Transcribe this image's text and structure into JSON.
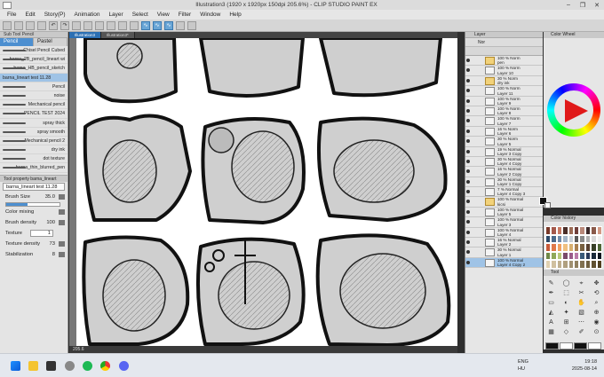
{
  "window": {
    "title": "Illustration3 (1920 x 1920px 150dpi 205.6%)  - CLIP STUDIO PAINT EX",
    "buttons": [
      "–",
      "❐",
      "✕"
    ]
  },
  "menu": [
    "File",
    "Edit",
    "Story(P)",
    "Animation",
    "Layer",
    "Select",
    "View",
    "Filter",
    "Window",
    "Help"
  ],
  "subtool_panel": {
    "title": "Sub Tool  Pencil",
    "tabs": [
      "Pencil",
      "Pastel"
    ],
    "brushes": [
      "Chisel Pencil Cubed",
      "barna_2B_pencil_lineart wi",
      "barna_HB_pencil_sketch",
      "barna_lineart test 11.28",
      "Pencil",
      "noise",
      "Mechanical pencil",
      "PENCIL TEST 2024",
      "spray thick",
      "spray smooth",
      "Mechanical pencil 2",
      "dry ink",
      "dot texture",
      "barna_thin_blurred_pen"
    ],
    "selected_index": 3
  },
  "tool_property": {
    "title": "Tool property  barna_lineart",
    "name": "barna_lineart test 11.28",
    "brush_size_label": "Brush Size",
    "brush_size_value": "35.0",
    "color_mixing_label": "Color mixing",
    "brush_density_label": "Brush density",
    "brush_density_value": "100",
    "texture_label": "Texture",
    "texture_value": "1",
    "texture_density_label": "Texture density",
    "texture_density_value": "73",
    "stabilization_label": "Stabilization",
    "stabilization_value": "8"
  },
  "canvas": {
    "tabs": [
      "Illustration3",
      "Illustration3*"
    ],
    "zoom": "205.6"
  },
  "layer_panel": {
    "title": "Layer",
    "blend_mode": "Nor",
    "layers": [
      {
        "line1": "100 % Norm",
        "line2": "pen",
        "folder": true
      },
      {
        "line1": "100 % Norm",
        "line2": "Layer 10"
      },
      {
        "line1": "30 % Norm",
        "line2": "dry ink",
        "folder": true
      },
      {
        "line1": "100 % Norm",
        "line2": "Layer 11"
      },
      {
        "line1": "100 % Norm",
        "line2": "Layer 9"
      },
      {
        "line1": "100 % Norm",
        "line2": "Layer 8"
      },
      {
        "line1": "100 % Norm",
        "line2": "Layer 7"
      },
      {
        "line1": "16 % Norm",
        "line2": "Layer 6"
      },
      {
        "line1": "30 % Norm",
        "line2": "Layer 5"
      },
      {
        "line1": "19 % Normal",
        "line2": "Layer 3 Copy"
      },
      {
        "line1": "30 % Normal",
        "line2": "Layer 4 Copy"
      },
      {
        "line1": "16 % Normal",
        "line2": "Layer 2 Copy"
      },
      {
        "line1": "30 % Normal",
        "line2": "Layer 1 Copy"
      },
      {
        "line1": "7 % Normal",
        "line2": "Layer 4 Copy 3"
      },
      {
        "line1": "100 % Normal",
        "line2": "kicsi",
        "folder": true
      },
      {
        "line1": "100 % Normal",
        "line2": "Layer 5"
      },
      {
        "line1": "100 % Normal",
        "line2": "Layer 3"
      },
      {
        "line1": "100 % Normal",
        "line2": "Layer 4"
      },
      {
        "line1": "16 % Normal",
        "line2": "Layer 2"
      },
      {
        "line1": "30 % Normal",
        "line2": "Layer 1"
      },
      {
        "line1": "100 % Normal",
        "line2": "Layer 4 Copy 2",
        "selected": true
      }
    ]
  },
  "color_wheel": {
    "title": "Color Wheel",
    "main_color": "#111111",
    "sub_color": "#ffffff"
  },
  "color_history": {
    "title": "Color history",
    "swatches": [
      "#7a3a2a",
      "#a4584a",
      "#c77a64",
      "#4a2e28",
      "#9b6b55",
      "#6f3f3a",
      "#b9897a",
      "#3d2a2a",
      "#8a5a4a",
      "#d19a85",
      "#2d4a6a",
      "#4b6a8a",
      "#6f8aa8",
      "#a3b5c8",
      "#c8d0d8",
      "#5a5a5a",
      "#8a8a8a",
      "#b0b0b0",
      "#d8d8d8",
      "#f0f0f0",
      "#c85a3a",
      "#e07a4a",
      "#f0a060",
      "#f0c080",
      "#d8b070",
      "#a88050",
      "#786040",
      "#584030",
      "#384028",
      "#506838",
      "#708848",
      "#90a858",
      "#b8c878",
      "#7a4a6a",
      "#9a5a8a",
      "#ba7aa8",
      "#3a5a7a",
      "#2a3a5a",
      "#1a2a3a",
      "#101820",
      "#e0d0b0",
      "#d0c0a0",
      "#c0b090",
      "#b0a080",
      "#a09070",
      "#908060",
      "#807050",
      "#706040",
      "#605030",
      "#504020"
    ]
  },
  "tool_panel": {
    "title": "Tool",
    "icons": [
      "✎",
      "◯",
      "⌖",
      "✥",
      "✒",
      "⬚",
      "✂",
      "⟲",
      "▭",
      "◐",
      "✋",
      "⌕",
      "◭",
      "✦",
      "▧",
      "⊕",
      "A",
      "⊞",
      "⋯",
      "◉",
      "▦",
      "◇",
      "✐",
      "⊙"
    ],
    "bottom_colors": [
      "#111111",
      "#ffffff",
      "#111111",
      "#ffffff"
    ]
  },
  "taskbar": {
    "icons": [
      "windows-icon",
      "explorer-icon",
      "clip-icon",
      "settings-icon",
      "spotify-icon",
      "chrome-icon",
      "discord-icon"
    ],
    "lang": "ENG",
    "lang_sub": "HU",
    "time": "19:18",
    "date": "2025-08-14"
  }
}
